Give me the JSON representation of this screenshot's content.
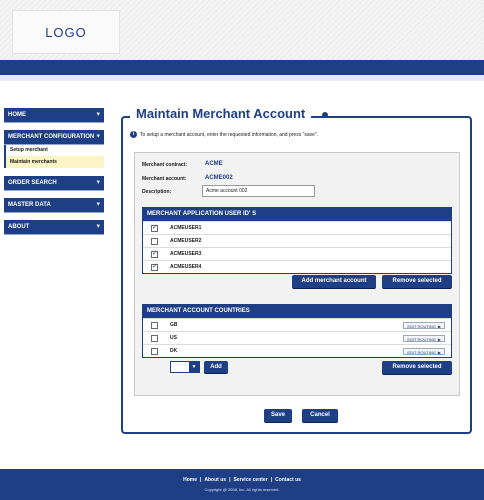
{
  "header": {
    "logo_text": "LOGO"
  },
  "colors": {
    "brand": "#1e3f86",
    "active_submenu": "#fbf4c4",
    "panel_bg": "#f2f2f2"
  },
  "sidebar": {
    "items": [
      {
        "label": "HOME"
      },
      {
        "label": "MERCHANT CONFIGURATION",
        "sub": [
          "Setup merchant",
          "Maintain merchants"
        ],
        "active_sub": "Maintain merchants"
      },
      {
        "label": "ORDER SEARCH"
      },
      {
        "label": "MASTER DATA"
      },
      {
        "label": "ABOUT"
      }
    ]
  },
  "main": {
    "title": "Maintain Merchant Account",
    "info_icon": "info-icon",
    "instructions": "To setup a merchant account, enter the requested information, and press \"save\".",
    "merchant_contract_label": "Merchant contract:",
    "merchant_contract_value": "ACME",
    "merchant_account_label": "Merchant account:",
    "merchant_account_value": "ACME002",
    "description_label": "Description:",
    "description_value": "Acme account 002",
    "users_table": {
      "header": "MERCHANT APPLICATION USER ID' S",
      "rows": [
        {
          "label": "ACMEUSER1",
          "checked": true
        },
        {
          "label": "ACMEUSER2",
          "checked": false
        },
        {
          "label": "ACMEUSER3",
          "checked": true
        },
        {
          "label": "ACMEUSER4",
          "checked": true
        }
      ]
    },
    "add_merchant_account_label": "Add merchant account",
    "remove_selected_label": "Remove selected",
    "countries_table": {
      "header": "MERCHANT ACCOUNT COUNTRIES",
      "edit_routing_label": "EDIT ROUTING",
      "rows": [
        {
          "label": "GB",
          "checked": false
        },
        {
          "label": "US",
          "checked": false
        },
        {
          "label": "DK",
          "checked": false
        }
      ]
    },
    "add_label": "Add",
    "remove_selected_label_2": "Remove selected",
    "save_label": "Save",
    "cancel_label": "Cancel"
  },
  "footer": {
    "links": [
      "Home",
      "About us",
      "Service center",
      "Contact us"
    ],
    "separator": "|",
    "copyright": "Copyright @ 2008, Inc. All rights reserved."
  }
}
